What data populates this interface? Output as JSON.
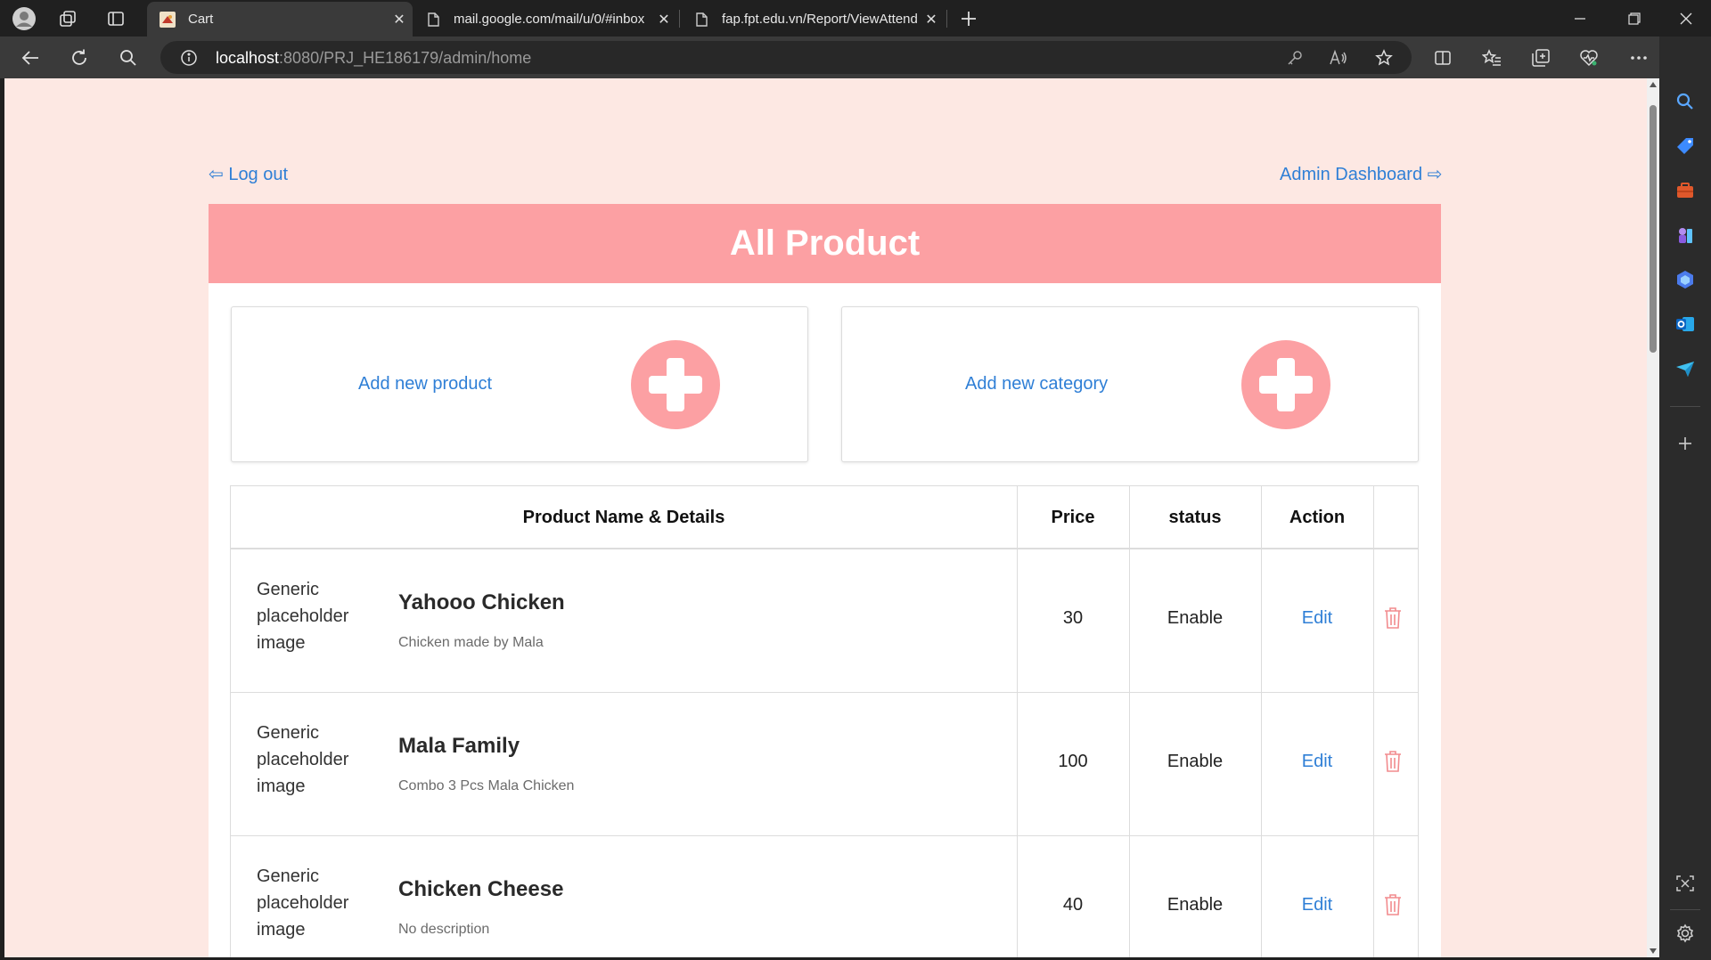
{
  "browser": {
    "tabs": [
      {
        "title": "Cart",
        "active": true
      },
      {
        "title": "mail.google.com/mail/u/0/#inbox",
        "active": false
      },
      {
        "title": "fap.fpt.edu.vn/Report/ViewAttendstudent",
        "active": false
      }
    ],
    "address": {
      "host": "localhost",
      "path": ":8080/PRJ_HE186179/admin/home"
    }
  },
  "page": {
    "logout_label": "⇦ Log out",
    "dashboard_label": "Admin Dashboard ⇨",
    "title": "All Product",
    "add_product_label": "Add new product",
    "add_category_label": "Add new category",
    "table": {
      "headers": {
        "details": "Product Name & Details",
        "price": "Price",
        "status": "status",
        "action": "Action"
      },
      "image_alt": "Generic placeholder image",
      "rows": [
        {
          "name": "Yahooo Chicken",
          "desc": "Chicken made by Mala",
          "price": "30",
          "status": "Enable",
          "edit": "Edit"
        },
        {
          "name": "Mala Family",
          "desc": "Combo 3 Pcs Mala Chicken",
          "price": "100",
          "status": "Enable",
          "edit": "Edit"
        },
        {
          "name": "Chicken Cheese",
          "desc": "No description",
          "price": "40",
          "status": "Enable",
          "edit": "Edit"
        }
      ]
    }
  },
  "colors": {
    "accent": "#fca0a3",
    "background": "#fde8e3",
    "link": "#2f7fd6",
    "delete": "#f28b8e"
  }
}
